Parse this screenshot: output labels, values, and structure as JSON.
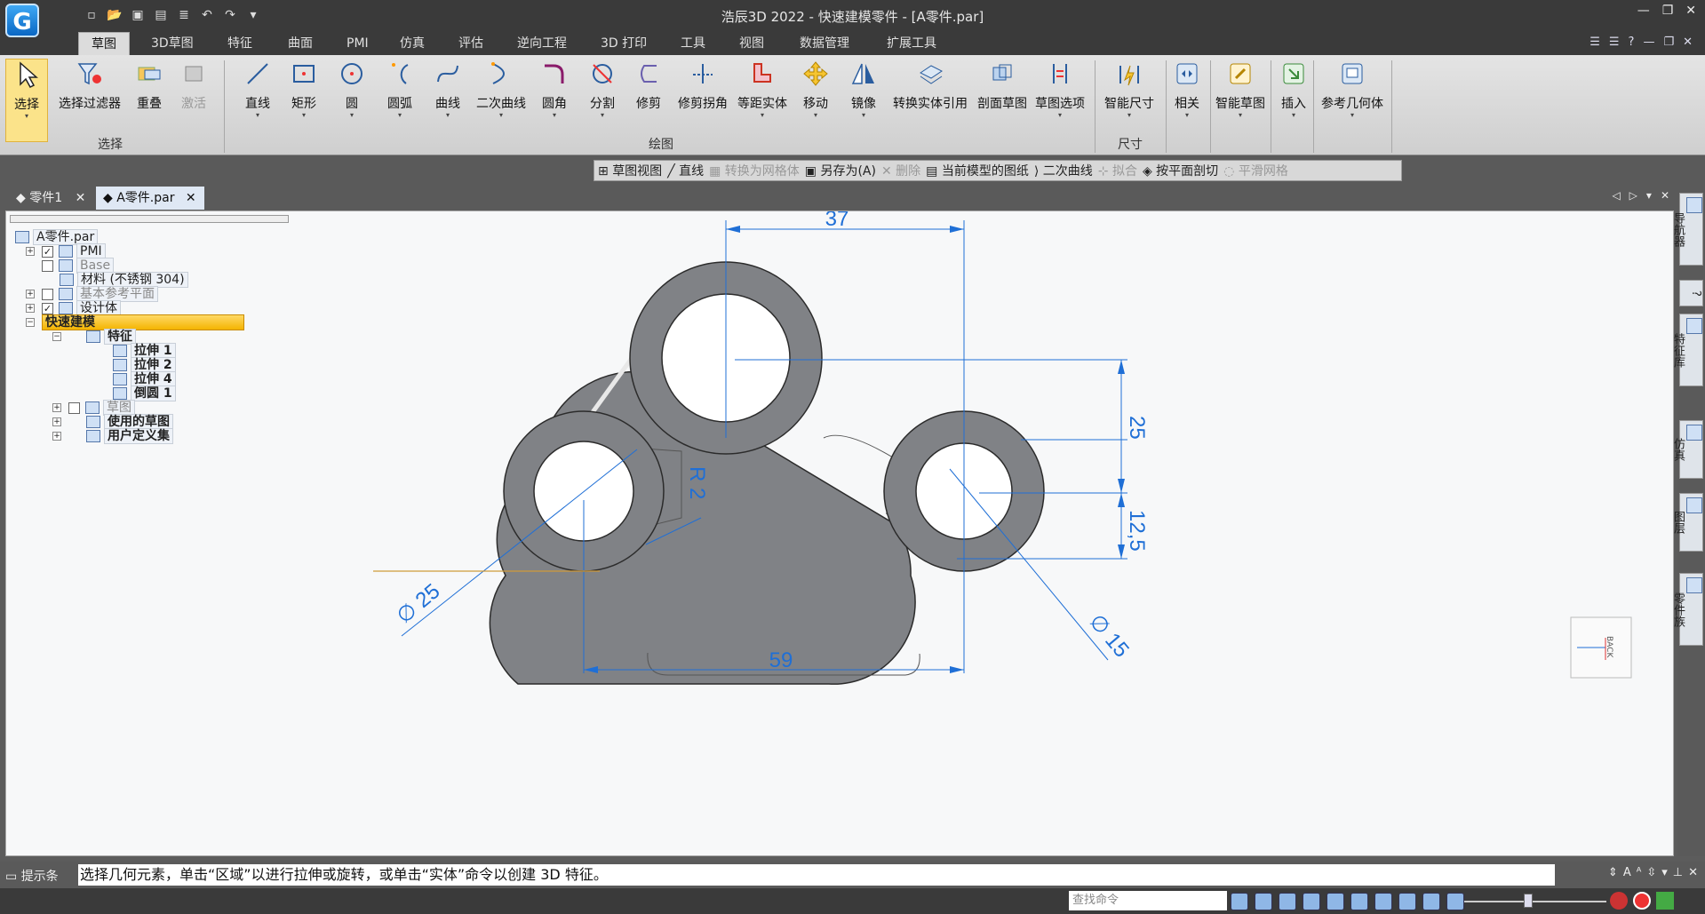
{
  "app": {
    "window_title": "浩辰3D 2022 - 快速建模零件 - [A零件.par]",
    "logo_text": "G"
  },
  "ribbon_tabs": [
    "草图",
    "3D草图",
    "特征",
    "曲面",
    "PMI",
    "仿真",
    "评估",
    "逆向工程",
    "3D 打印",
    "工具",
    "视图",
    "数据管理",
    "扩展工具"
  ],
  "ribbon": {
    "select_group": {
      "label": "选择",
      "buttons": [
        "选择",
        "选择过滤器",
        "重叠",
        "激活"
      ]
    },
    "draw_group": {
      "label": "绘图",
      "buttons": [
        "直线",
        "矩形",
        "圆",
        "圆弧",
        "曲线",
        "二次曲线",
        "圆角",
        "分割",
        "修剪",
        "修剪拐角",
        "等距实体",
        "移动",
        "镜像",
        "转换实体引用",
        "剖面草图",
        "草图选项"
      ]
    },
    "dim_group": {
      "label": "尺寸",
      "buttons": [
        "智能尺寸"
      ]
    },
    "other_buttons": [
      "相关",
      "智能草图",
      "插入",
      "参考几何体"
    ]
  },
  "context_toolbar": [
    {
      "label": "草图视图",
      "enabled": true
    },
    {
      "label": "直线",
      "enabled": true
    },
    {
      "label": "转换为网格体",
      "enabled": false
    },
    {
      "label": "另存为(A)",
      "enabled": true
    },
    {
      "label": "删除",
      "enabled": false
    },
    {
      "label": "当前模型的图纸",
      "enabled": true
    },
    {
      "label": "二次曲线",
      "enabled": true
    },
    {
      "label": "拟合",
      "enabled": false
    },
    {
      "label": "按平面剖切",
      "enabled": true
    },
    {
      "label": "平滑网格",
      "enabled": false
    }
  ],
  "doc_tabs": [
    "零件1",
    "A零件.par"
  ],
  "tree": {
    "root": "A零件.par",
    "items": {
      "pmi": "PMI",
      "base": "Base",
      "material": "材料 (不锈钢 304)",
      "ref_planes": "基本参考平面",
      "design_body": "设计体",
      "quick_model": "快速建模",
      "features": "特征",
      "extrude1": "拉伸 1",
      "extrude2": "拉伸 2",
      "extrude4": "拉伸 4",
      "fillet1": "倒圆 1",
      "sketch": "草图",
      "used_sketch": "使用的草图",
      "user_sets": "用户定义集"
    }
  },
  "drawing": {
    "dim_37": "37",
    "dim_25": "25",
    "dim_12_5": "12,5",
    "dim_r2": "R 2",
    "dim_d25": "∅ 25",
    "dim_d15": "∅ 15",
    "dim_59": "59",
    "view_cube": "BACK"
  },
  "side_tabs": [
    "导航器",
    "?",
    "特征库",
    "仿真",
    "图层",
    "零件族"
  ],
  "prompt": {
    "label": "提示条",
    "text": "选择几何元素，单击“区域”以进行拉伸或旋转，或单击“实体”命令以创建 3D 特征。"
  },
  "status": {
    "search_placeholder": "查找命令"
  },
  "colors": {
    "part_fill": "#7f8185",
    "dimension": "#1f6fd6",
    "highlight": "#f4b400"
  }
}
